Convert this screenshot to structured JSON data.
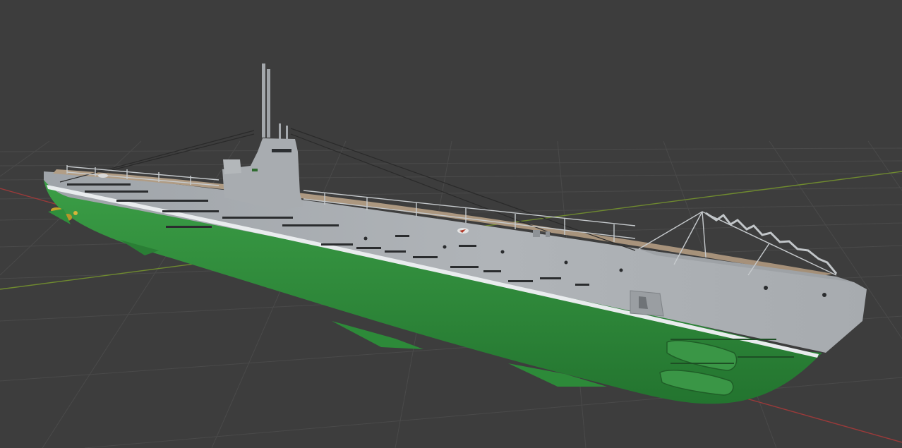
{
  "viewport": {
    "background": "#3d3d3d",
    "grid_color": "#4a4a4a",
    "x_axis_color": "#9a3a3a",
    "y_axis_color": "#6f8a2f"
  },
  "model": {
    "hull_upper_color": "#a9adb1",
    "hull_lower_color": "#2f8f3c",
    "deck_color": "#a5917a",
    "stripe_color": "#e9ecee"
  }
}
